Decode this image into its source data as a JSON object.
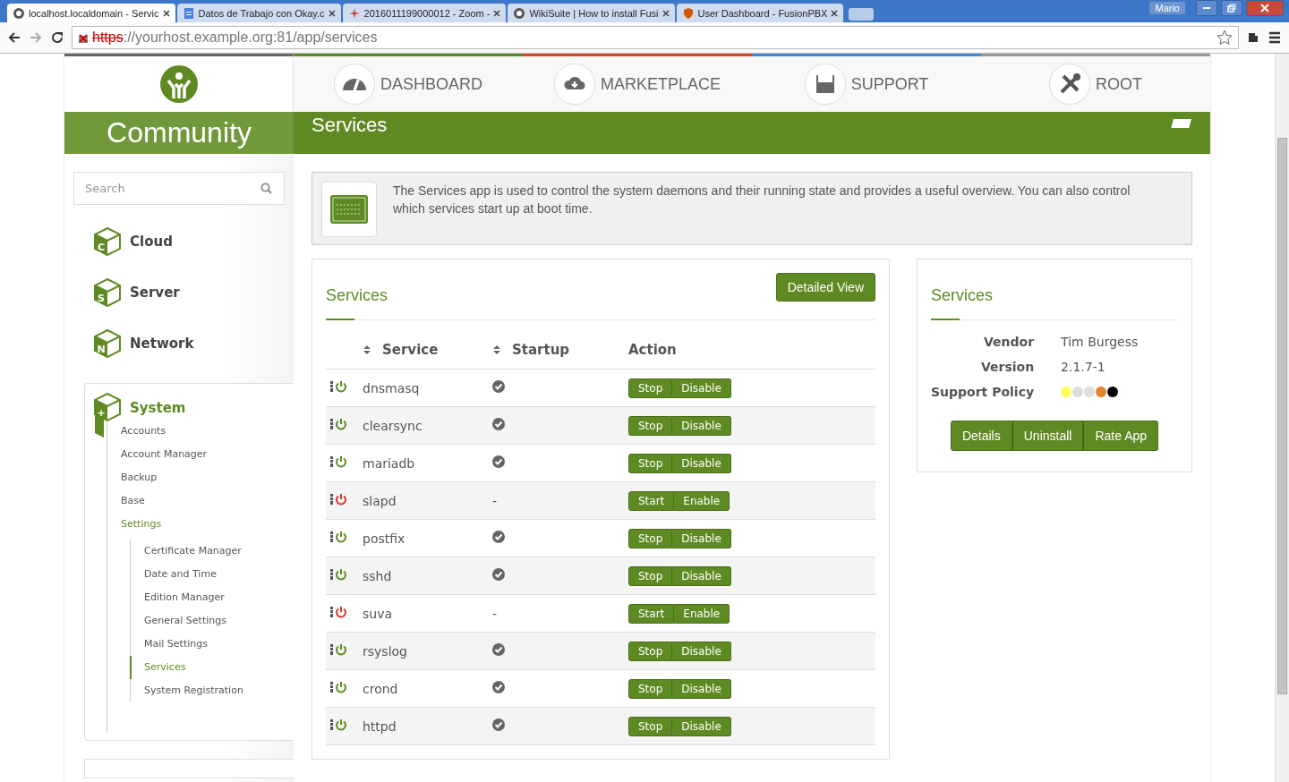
{
  "browser": {
    "tabs": [
      {
        "title": "localhost.localdomain - Servic",
        "selected": true
      },
      {
        "title": "Datos de Trabajo con Okay.c",
        "selected": false
      },
      {
        "title": "2016011199000012 - Zoom -",
        "selected": false
      },
      {
        "title": "WikiSuite | How to install Fusi",
        "selected": false
      },
      {
        "title": "User Dashboard - FusionPBX",
        "selected": false
      }
    ],
    "user": "Mario",
    "url_scheme": "https",
    "url_host": "://yourhost.example.org",
    "url_path": ":81/app/services"
  },
  "header": {
    "brand": "Community",
    "breadcrumb": "Services",
    "nav": [
      {
        "label": "DASHBOARD",
        "kind": "gauge",
        "color": "#5f8a23"
      },
      {
        "label": "MARKETPLACE",
        "kind": "cloud",
        "color": "#d9461b"
      },
      {
        "label": "SUPPORT",
        "kind": "inbox",
        "color": "#3a8bd6"
      },
      {
        "label": "ROOT",
        "kind": "tools",
        "color": "#9a9a9a"
      }
    ]
  },
  "sidebar": {
    "search": {
      "placeholder": "Search"
    },
    "categories": [
      {
        "label": "Cloud",
        "letter": "C"
      },
      {
        "label": "Server",
        "letter": "S"
      },
      {
        "label": "Network",
        "letter": "N"
      }
    ],
    "system": {
      "label": "System",
      "letter": "+",
      "expanded": true,
      "children": [
        {
          "label": "Accounts",
          "selected": false
        },
        {
          "label": "Account Manager",
          "selected": false
        },
        {
          "label": "Backup",
          "selected": false
        },
        {
          "label": "Base",
          "selected": false
        },
        {
          "label": "Settings",
          "selected": true,
          "children": [
            {
              "label": "Certificate Manager",
              "selected": false
            },
            {
              "label": "Date and Time",
              "selected": false
            },
            {
              "label": "Edition Manager",
              "selected": false
            },
            {
              "label": "General Settings",
              "selected": false
            },
            {
              "label": "Mail Settings",
              "selected": false
            },
            {
              "label": "Services",
              "selected": true
            },
            {
              "label": "System Registration",
              "selected": false
            }
          ]
        }
      ]
    }
  },
  "info": {
    "text": "The Services app is used to control the system daemons and their running state and provides a useful overview. You can also control which services start up at boot time."
  },
  "services": {
    "title": "Services",
    "detailed_button": "Detailed View",
    "columns": [
      "Service",
      "Startup",
      "Action"
    ],
    "rows": [
      {
        "name": "dnsmasq",
        "running": true,
        "enabled": true,
        "actions": [
          "Stop",
          "Disable"
        ]
      },
      {
        "name": "clearsync",
        "running": true,
        "enabled": true,
        "actions": [
          "Stop",
          "Disable"
        ]
      },
      {
        "name": "mariadb",
        "running": true,
        "enabled": true,
        "actions": [
          "Stop",
          "Disable"
        ]
      },
      {
        "name": "slapd",
        "running": false,
        "enabled": false,
        "startup": "-",
        "actions": [
          "Start",
          "Enable"
        ]
      },
      {
        "name": "postfix",
        "running": true,
        "enabled": true,
        "actions": [
          "Stop",
          "Disable"
        ]
      },
      {
        "name": "sshd",
        "running": true,
        "enabled": true,
        "actions": [
          "Stop",
          "Disable"
        ]
      },
      {
        "name": "suva",
        "running": false,
        "enabled": false,
        "startup": "-",
        "actions": [
          "Start",
          "Enable"
        ]
      },
      {
        "name": "rsyslog",
        "running": true,
        "enabled": true,
        "actions": [
          "Stop",
          "Disable"
        ]
      },
      {
        "name": "crond",
        "running": true,
        "enabled": true,
        "actions": [
          "Stop",
          "Disable"
        ]
      },
      {
        "name": "httpd",
        "running": true,
        "enabled": true,
        "actions": [
          "Stop",
          "Disable"
        ]
      }
    ]
  },
  "app_info": {
    "title": "Services",
    "fields": [
      {
        "label": "Vendor",
        "value": "Tim Burgess"
      },
      {
        "label": "Version",
        "value": "2.1.7-1"
      }
    ],
    "support_policy": {
      "label": "Support Policy",
      "dots": [
        {
          "color": "#fcfc5a"
        },
        {
          "color": "#dddddd"
        },
        {
          "color": "#dddddd"
        },
        {
          "color": "#e5822a"
        },
        {
          "color": "#000000"
        }
      ]
    },
    "buttons": [
      "Details",
      "Uninstall",
      "Rate App"
    ]
  }
}
